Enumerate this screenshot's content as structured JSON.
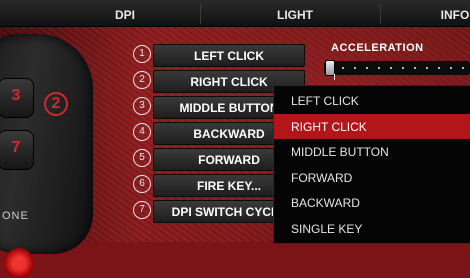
{
  "tabs": {
    "dpi": "DPI",
    "light": "LIGHT",
    "info": "INFO"
  },
  "mouse": {
    "buttons": [
      "3",
      "2",
      "7"
    ],
    "label": "ONE"
  },
  "buttons": [
    {
      "num": "1",
      "action": "LEFT CLICK"
    },
    {
      "num": "2",
      "action": "RIGHT CLICK"
    },
    {
      "num": "3",
      "action": "MIDDLE BUTTON"
    },
    {
      "num": "4",
      "action": "BACKWARD"
    },
    {
      "num": "5",
      "action": "FORWARD"
    },
    {
      "num": "6",
      "action": "FIRE KEY..."
    },
    {
      "num": "7",
      "action": "DPI SWITCH CYCLE"
    }
  ],
  "acceleration": {
    "label": "ACCELERATION",
    "level": 0
  },
  "dropdown": {
    "selected_index": 1,
    "options": [
      "LEFT CLICK",
      "RIGHT CLICK",
      "MIDDLE BUTTON",
      "FORWARD",
      "BACKWARD",
      "SINGLE KEY"
    ]
  },
  "colors": {
    "accent": "#b31619",
    "background": "#7a1416"
  }
}
